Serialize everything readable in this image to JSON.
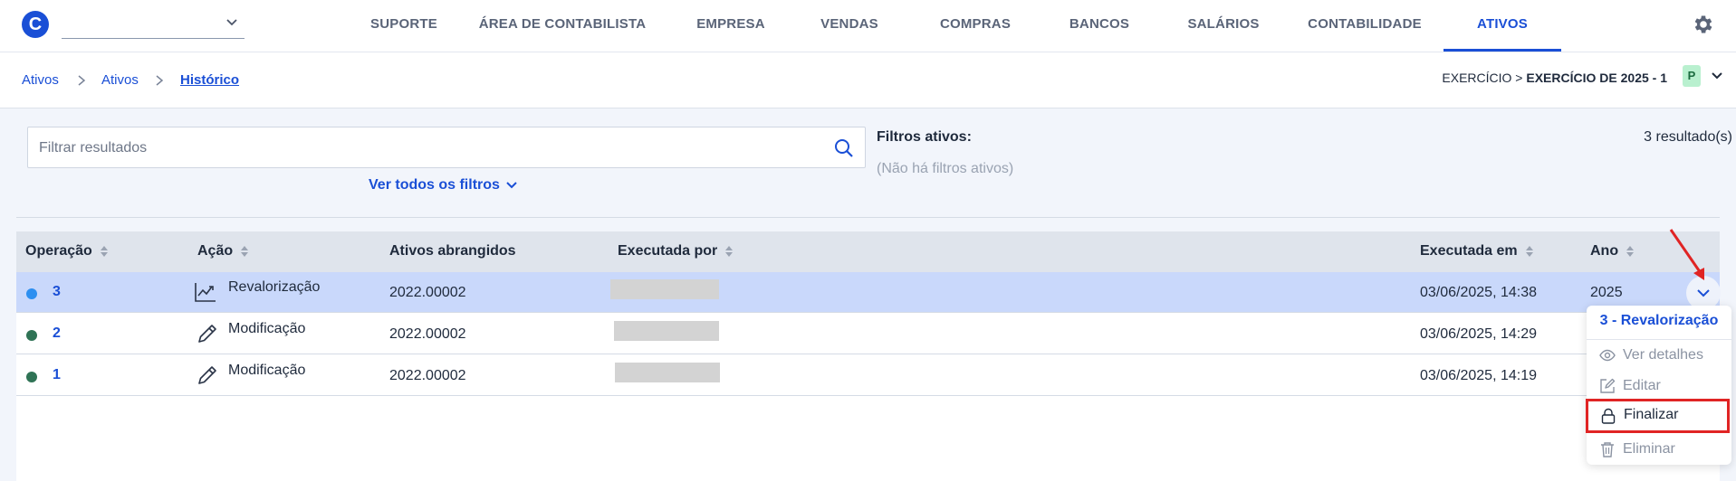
{
  "app": {
    "logo_letter": "C",
    "accent": "#1a4fd6"
  },
  "nav": {
    "items": [
      {
        "label": "SUPORTE"
      },
      {
        "label": "ÁREA DE CONTABILISTA"
      },
      {
        "label": "EMPRESA"
      },
      {
        "label": "VENDAS"
      },
      {
        "label": "COMPRAS"
      },
      {
        "label": "BANCOS"
      },
      {
        "label": "SALÁRIOS"
      },
      {
        "label": "CONTABILIDADE"
      },
      {
        "label": "ATIVOS"
      }
    ],
    "active": "ATIVOS"
  },
  "breadcrumb": {
    "items": [
      "Ativos",
      "Ativos",
      "Histórico"
    ],
    "exercicio_prefix": "EXERCÍCIO > ",
    "exercicio_value": "EXERCÍCIO DE 2025 - 1",
    "badge": "P"
  },
  "filters": {
    "placeholder": "Filtrar resultados",
    "all_filters_label": "Ver todos os filtros",
    "active_label": "Filtros ativos:",
    "none_label": "(Não há filtros ativos)",
    "results": "3 resultado(s)"
  },
  "table": {
    "columns": [
      "Operação",
      "Ação",
      "Ativos abrangidos",
      "Executada por",
      "Executada em",
      "Ano"
    ],
    "rows": [
      {
        "op": "3",
        "status_color": "#2d8ff0",
        "action": "Revalorização",
        "action_icon": "chart-line-icon",
        "assets": "2022.00002",
        "date": "03/06/2025, 14:38",
        "year": "2025"
      },
      {
        "op": "2",
        "status_color": "#2f7355",
        "action": "Modificação",
        "action_icon": "pencil-icon",
        "assets": "2022.00002",
        "date": "03/06/2025, 14:29",
        "year": ""
      },
      {
        "op": "1",
        "status_color": "#2f7355",
        "action": "Modificação",
        "action_icon": "pencil-icon",
        "assets": "2022.00002",
        "date": "03/06/2025, 14:19",
        "year": ""
      }
    ]
  },
  "dropdown": {
    "title": "3 - Revalorização",
    "items": [
      {
        "label": "Ver detalhes",
        "icon": "eye-icon"
      },
      {
        "label": "Editar",
        "icon": "edit-icon"
      },
      {
        "label": "Finalizar",
        "icon": "lock-icon"
      },
      {
        "label": "Eliminar",
        "icon": "trash-icon"
      }
    ]
  }
}
